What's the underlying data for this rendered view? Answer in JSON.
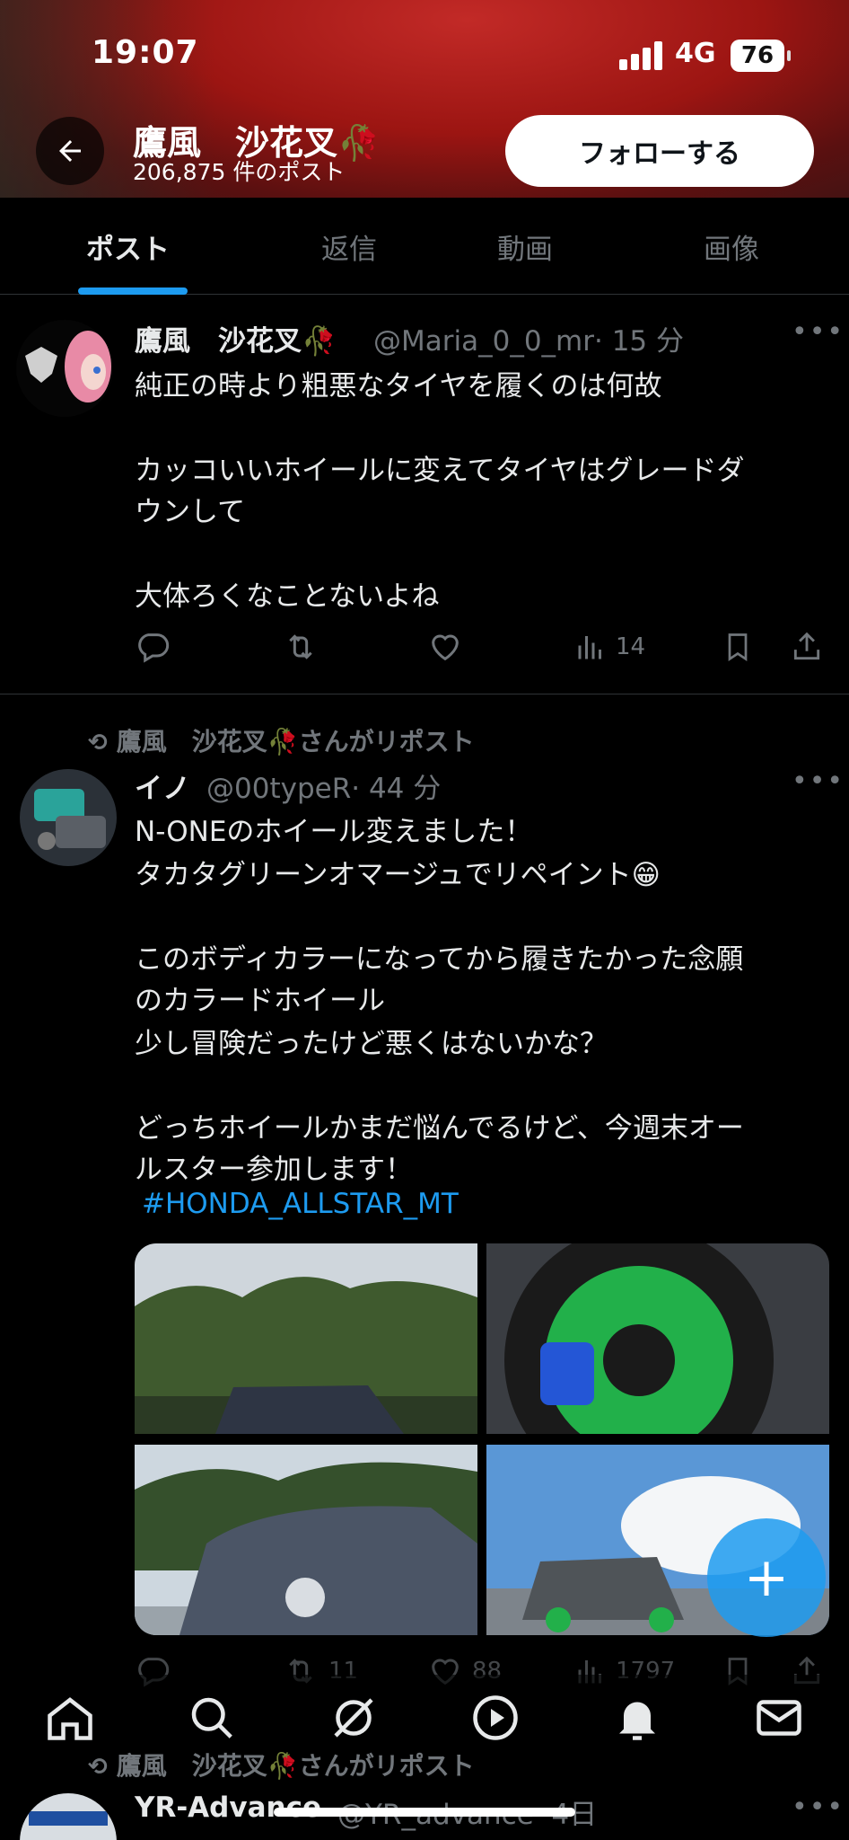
{
  "status_bar": {
    "time": "19:07",
    "network": "4G",
    "battery": "76"
  },
  "header": {
    "name": "鷹風　沙花叉🥀",
    "post_count": "206,875 件のポスト",
    "follow_label": "フォローする"
  },
  "tabs": [
    "ポスト",
    "返信",
    "動画",
    "画像"
  ],
  "posts": [
    {
      "name": "鷹風　沙花叉🥀",
      "handle": "@Maria_0_0_mr",
      "time": "· 15 分",
      "lines": [
        "純正の時より粗悪なタイヤを履くのは何故",
        "",
        "カッコいいホイールに変えてタイヤはグレードダ",
        "ウンして",
        "",
        "大体ろくなことないよね"
      ],
      "views": "14"
    },
    {
      "repost_label": "鷹風　沙花叉🥀さんがリポスト",
      "name": "イノ",
      "handle": "@00typeR",
      "time": "· 44 分",
      "lines": [
        "N-ONEのホイール変えました！",
        "タカタグリーンオマージュでリペイント😁",
        "",
        "このボディカラーになってから履きたかった念願",
        "のカラードホイール",
        "少し冒険だったけど悪くはないかな？",
        "",
        "どっちホイールかまだ悩んでるけど、今週末オー",
        "ルスター参加します！"
      ],
      "hashtag": "#HONDA_ALLSTAR_MT",
      "reposts": "11",
      "likes": "88",
      "views": "1797"
    },
    {
      "repost_label": "鷹風　沙花叉🥀さんがリポスト",
      "name": "YR-Advance",
      "handle": "@YR_advance",
      "time": "· 4日"
    }
  ],
  "icons": {
    "back": "arrow-left-icon",
    "reply": "reply-icon",
    "repost": "repost-icon",
    "like": "heart-icon",
    "views": "views-icon",
    "bookmark": "bookmark-icon",
    "share": "share-icon",
    "compose": "plus-icon"
  },
  "colors": {
    "accent": "#1d9bf0",
    "header_red": "#9c1512"
  }
}
